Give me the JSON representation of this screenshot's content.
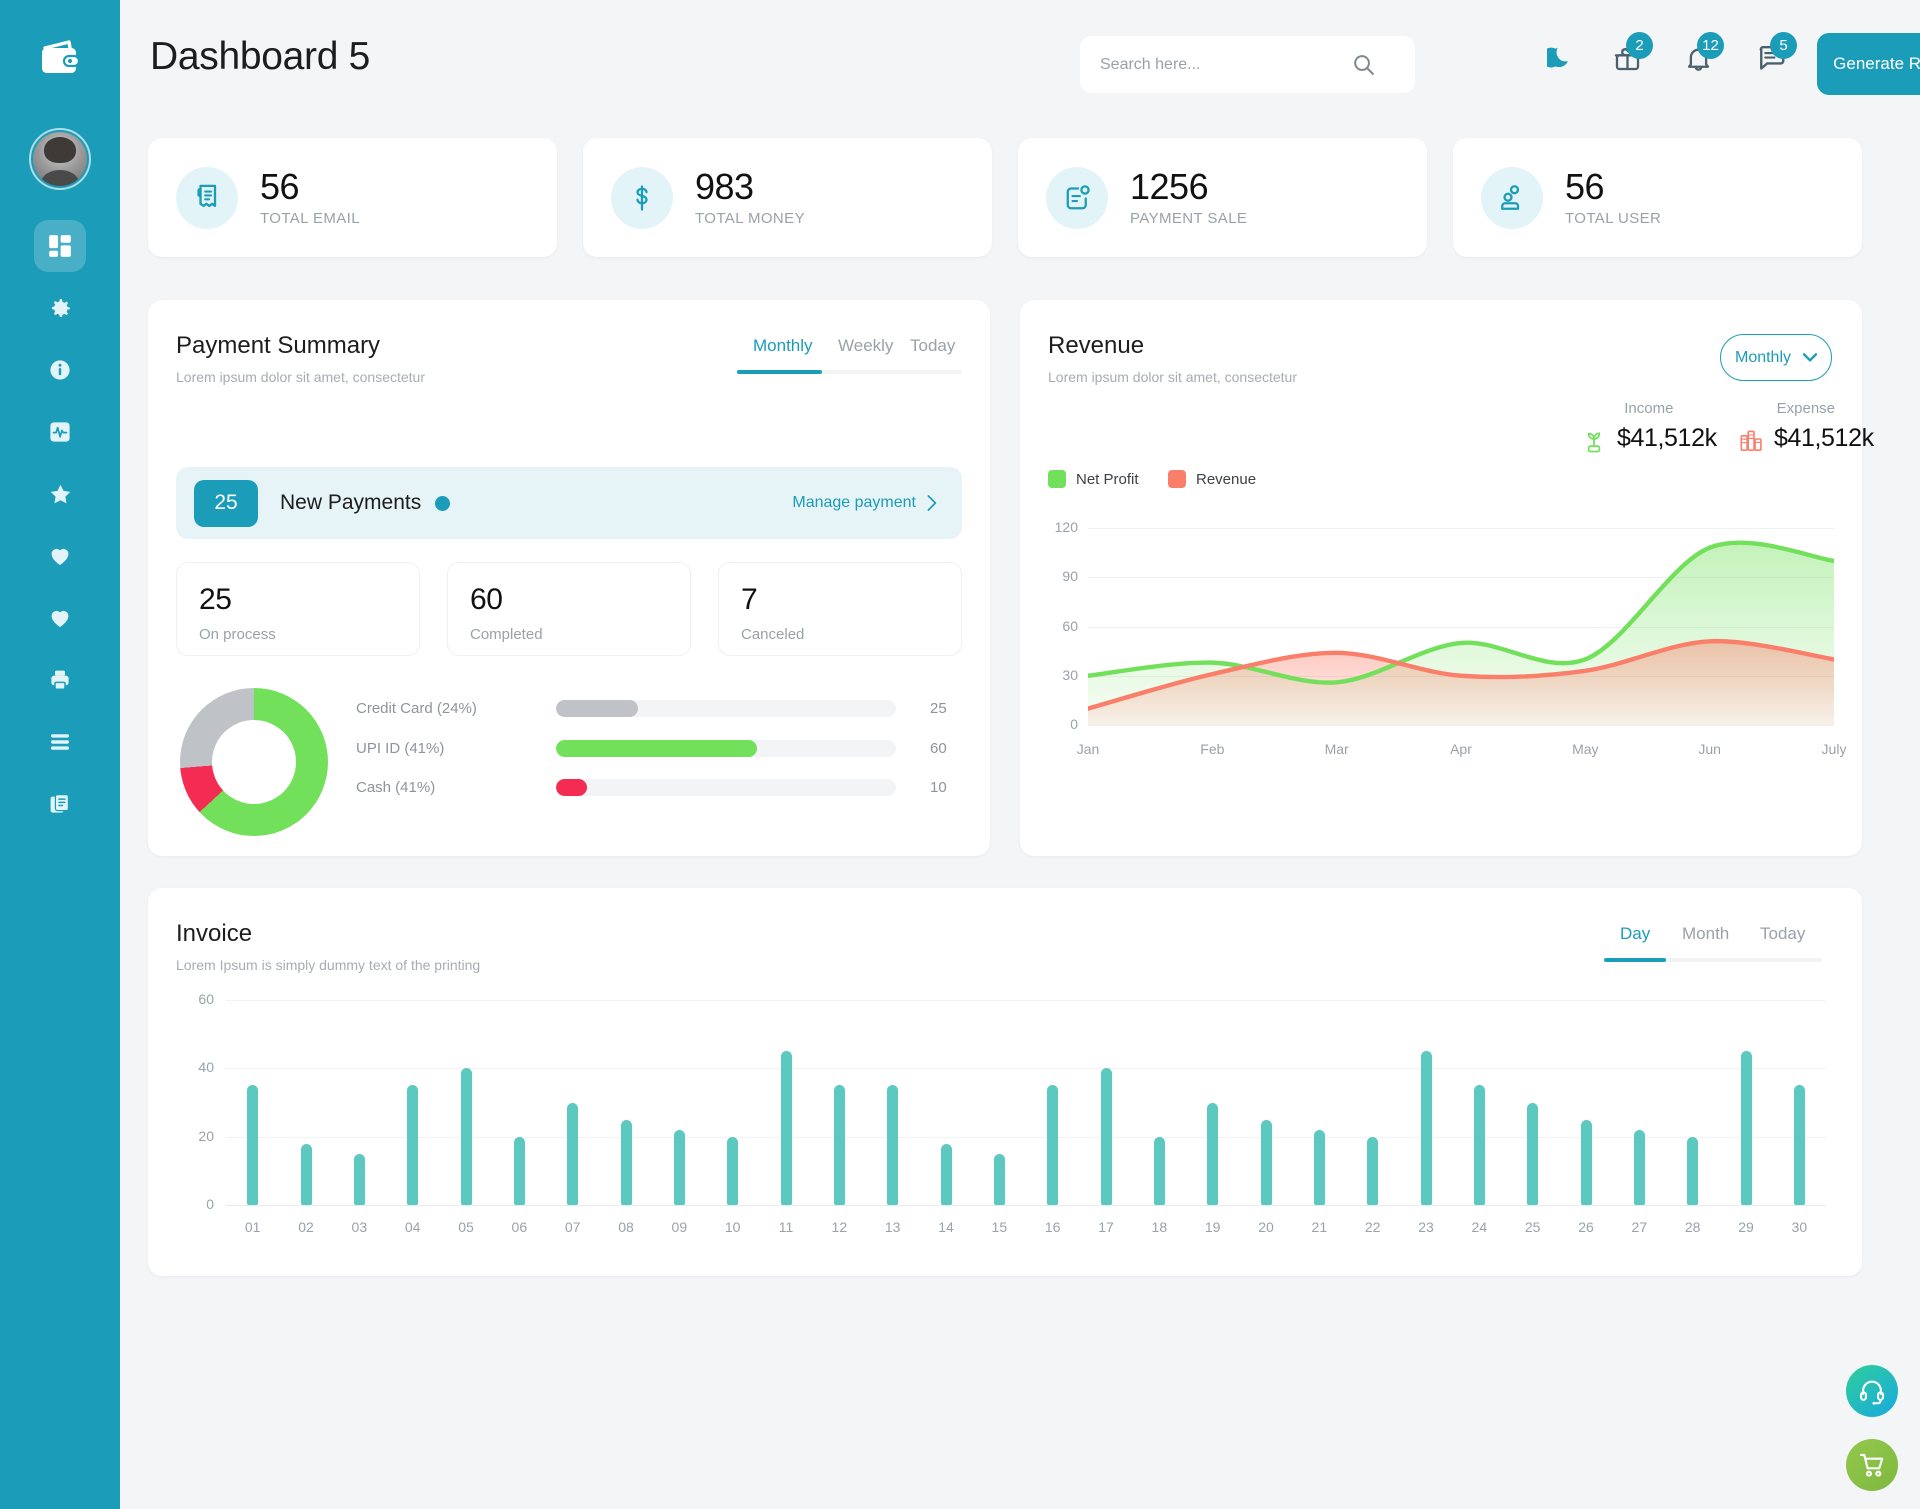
{
  "brand": {
    "logo_icon": "wallet-icon"
  },
  "sidebar": {
    "avatar_name": "user-avatar",
    "items": [
      {
        "icon": "dashboard-grid-icon",
        "name": "sidebar-item-dashboard",
        "active": true
      },
      {
        "icon": "gear-icon",
        "name": "sidebar-item-settings",
        "active": false
      },
      {
        "icon": "info-circle-icon",
        "name": "sidebar-item-info",
        "active": false
      },
      {
        "icon": "activity-pulse-icon",
        "name": "sidebar-item-analytics",
        "active": false
      },
      {
        "icon": "star-icon",
        "name": "sidebar-item-favorites",
        "active": false
      },
      {
        "icon": "heart-icon",
        "name": "sidebar-item-likes",
        "active": false
      },
      {
        "icon": "heart-icon",
        "name": "sidebar-item-wishlist",
        "active": false
      },
      {
        "icon": "printer-icon",
        "name": "sidebar-item-print",
        "active": false
      },
      {
        "icon": "menu-lines-icon",
        "name": "sidebar-item-menu",
        "active": false
      },
      {
        "icon": "documents-icon",
        "name": "sidebar-item-documents",
        "active": false
      }
    ]
  },
  "header": {
    "title": "Dashboard 5",
    "search": {
      "placeholder": "Search here...",
      "value": "",
      "icon": "search-icon"
    },
    "icons": [
      {
        "name": "moon-icon",
        "badge": ""
      },
      {
        "name": "gift-icon",
        "badge": "2"
      },
      {
        "name": "bell-icon",
        "badge": "12"
      },
      {
        "name": "message-icon",
        "badge": "5"
      }
    ],
    "generate_report": {
      "label": "Generate Report",
      "icon": "bar-chart-icon"
    }
  },
  "stats": [
    {
      "value": "56",
      "label": "TOTAL EMAIL",
      "icon": "receipt-icon"
    },
    {
      "value": "983",
      "label": "TOTAL MONEY",
      "icon": "dollar-icon"
    },
    {
      "value": "1256",
      "label": "PAYMENT SALE",
      "icon": "note-alert-icon"
    },
    {
      "value": "56",
      "label": "TOTAL USER",
      "icon": "users-icon"
    }
  ],
  "payment_summary": {
    "title": "Payment Summary",
    "subtitle": "Lorem ipsum dolor sit amet, consectetur",
    "tabs": [
      {
        "label": "Monthly",
        "active": true
      },
      {
        "label": "Weekly",
        "active": false
      },
      {
        "label": "Today",
        "active": false
      }
    ],
    "banner": {
      "count": "25",
      "label": "New Payments",
      "action": "Manage payment",
      "chevron": "chevron-right-icon"
    },
    "mini_cards": [
      {
        "value": "25",
        "label": "On process"
      },
      {
        "value": "60",
        "label": "Completed"
      },
      {
        "value": "7",
        "label": "Canceled"
      }
    ],
    "methods": [
      {
        "label": "Credit Card (24%)",
        "value": "25",
        "percent": 24,
        "color": "#bfc2c6"
      },
      {
        "label": "UPI ID (41%)",
        "value": "60",
        "percent": 59,
        "color": "#72e05a"
      },
      {
        "label": "Cash (41%)",
        "value": "10",
        "percent": 9,
        "color": "#f42b53"
      }
    ]
  },
  "revenue": {
    "title": "Revenue",
    "subtitle": "Lorem ipsum dolor sit amet, consectetur",
    "select": {
      "label": "Monthly",
      "icon": "chevron-down-icon"
    },
    "income": {
      "label": "Income",
      "value": "$41,512k",
      "icon": "money-plant-icon",
      "color": "#72e05a"
    },
    "expense": {
      "label": "Expense",
      "value": "$41,512k",
      "icon": "coins-icon",
      "color": "#fa7f6b"
    },
    "legend": [
      {
        "label": "Net Profit",
        "color": "#72e05a"
      },
      {
        "label": "Revenue",
        "color": "#fa7f6b"
      }
    ]
  },
  "invoice": {
    "title": "Invoice",
    "subtitle": "Lorem Ipsum is simply dummy text of the printing",
    "tabs": [
      {
        "label": "Day",
        "active": true
      },
      {
        "label": "Month",
        "active": false
      },
      {
        "label": "Today",
        "active": false
      }
    ]
  },
  "fabs": [
    {
      "name": "support-headset-icon",
      "label": ""
    },
    {
      "name": "shopping-cart-icon",
      "label": ""
    }
  ],
  "chart_data": [
    {
      "type": "area",
      "title": "Revenue",
      "x": [
        "Jan",
        "Feb",
        "Mar",
        "Apr",
        "May",
        "Jun",
        "July"
      ],
      "series": [
        {
          "name": "Net Profit",
          "color": "#72e05a",
          "values": [
            30,
            38,
            26,
            50,
            40,
            108,
            100
          ]
        },
        {
          "name": "Revenue",
          "color": "#fa7f6b",
          "values": [
            10,
            31,
            44,
            30,
            33,
            51,
            40
          ]
        }
      ],
      "ylabel": "",
      "xlabel": "",
      "yticks": [
        0,
        30,
        60,
        90,
        120
      ],
      "ylim": [
        0,
        120
      ],
      "grid": true,
      "legend_position": "top-left"
    },
    {
      "type": "bar",
      "title": "Invoice",
      "categories": [
        "01",
        "02",
        "03",
        "04",
        "05",
        "06",
        "07",
        "08",
        "09",
        "10",
        "11",
        "12",
        "13",
        "14",
        "15",
        "16",
        "17",
        "18",
        "19",
        "20",
        "21",
        "22",
        "23",
        "24",
        "25",
        "26",
        "27",
        "28",
        "29",
        "30"
      ],
      "values": [
        35,
        18,
        15,
        35,
        40,
        20,
        30,
        25,
        22,
        20,
        45,
        35,
        35,
        18,
        15,
        35,
        40,
        20,
        30,
        25,
        22,
        20,
        45,
        35,
        30,
        25,
        22,
        20,
        45,
        35
      ],
      "color": "#5bc9c0",
      "yticks": [
        0,
        20,
        40,
        60
      ],
      "ylim": [
        0,
        60
      ],
      "xlabel": "",
      "ylabel": "",
      "grid": true
    }
  ]
}
